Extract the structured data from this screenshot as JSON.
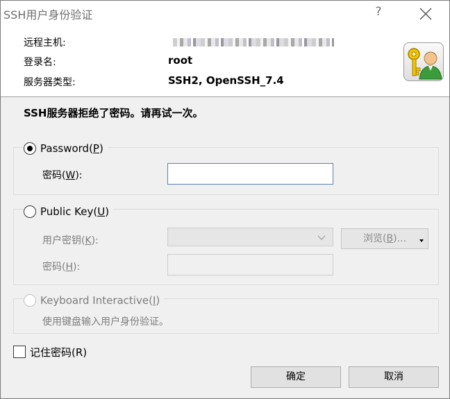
{
  "window": {
    "title": "SSH用户身份验证",
    "help_glyph": "?"
  },
  "info": {
    "host_label": "远程主机:",
    "user_label": "登录名:",
    "user_value": "root",
    "server_label": "服务器类型:",
    "server_value": "SSH2, OpenSSH_7.4"
  },
  "message": "SSH服务器拒绝了密码。请再试一次。",
  "password_group": {
    "radio_label_pre": "Password(",
    "radio_label_key": "P",
    "radio_label_post": ")",
    "field_label_pre": "密码(",
    "field_label_key": "W",
    "field_label_post": "):",
    "field_value": ""
  },
  "pubkey_group": {
    "radio_label_pre": "Public Key(",
    "radio_label_key": "U",
    "radio_label_post": ")",
    "key_label_pre": "用户密钥(",
    "key_label_key": "K",
    "key_label_post": "):",
    "pass_label_pre": "密码(",
    "pass_label_key": "H",
    "pass_label_post": "):",
    "browse_label_pre": "浏览(",
    "browse_label_key": "B",
    "browse_label_post": ")..."
  },
  "keyboard_group": {
    "radio_label_pre": "Keyboard Interactive(",
    "radio_label_key": "I",
    "radio_label_post": ")",
    "description": "使用键盘输入用户身份验证。"
  },
  "remember": {
    "label": "记住密码(R)",
    "checked": false
  },
  "buttons": {
    "ok": "确定",
    "cancel": "取消"
  },
  "colors": {
    "titlebar": "#ffffff",
    "dialog_bg": "#f0f0f0",
    "focus_border": "#5b7eb5",
    "disabled_text": "#7d7d7d"
  }
}
